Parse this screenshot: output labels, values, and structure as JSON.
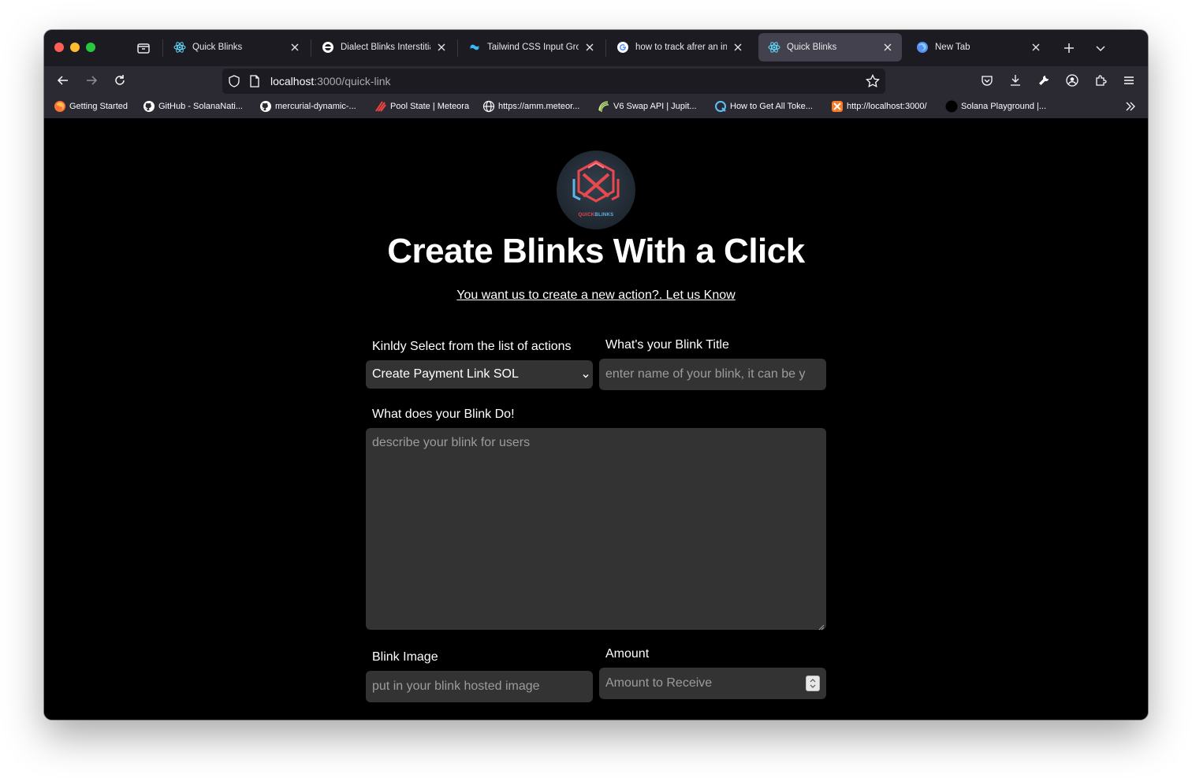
{
  "browser": {
    "tabs": [
      {
        "title": "Quick Blinks",
        "icon": "react-icon",
        "active": false
      },
      {
        "title": "Dialect Blinks Interstitial",
        "icon": "dialect-icon",
        "active": false
      },
      {
        "title": "Tailwind CSS Input Grou",
        "icon": "tailwind-icon",
        "active": false
      },
      {
        "title": "how to track afrer an inpu",
        "icon": "google-icon",
        "active": false
      },
      {
        "title": "Quick Blinks",
        "icon": "react-icon",
        "active": true
      },
      {
        "title": "New Tab",
        "icon": "firefox-icon",
        "active": false
      }
    ],
    "url": {
      "host": "localhost",
      "path": ":3000/quick-link"
    },
    "bookmarks": [
      {
        "label": "Getting Started",
        "icon": "firefox-icon"
      },
      {
        "label": "GitHub - SolanaNati...",
        "icon": "github-icon"
      },
      {
        "label": "mercurial-dynamic-...",
        "icon": "github-icon"
      },
      {
        "label": "Pool State | Meteora",
        "icon": "meteora-icon"
      },
      {
        "label": "https://amm.meteor...",
        "icon": "globe-icon"
      },
      {
        "label": "V6 Swap API | Jupit...",
        "icon": "jupiter-icon"
      },
      {
        "label": "How to Get All Toke...",
        "icon": "quicknode-icon"
      },
      {
        "label": "http://localhost:3000/",
        "icon": "xampp-icon"
      },
      {
        "label": "Solana Playground |...",
        "icon": "solana-playground-icon"
      }
    ]
  },
  "page": {
    "logo_text_red": "QUICK",
    "logo_text_blue": "BLINKS",
    "headline": "Create Blinks With a Click",
    "request_link": "You want us to create a new action?. Let us Know",
    "form": {
      "action_label": "Kinldy Select from the list of actions",
      "action_value": "Create Payment Link SOL",
      "title_label": "What's your Blink Title",
      "title_placeholder": "enter name of your blink, it can be y",
      "description_label": "What does your Blink Do!",
      "description_placeholder": "describe your blink for users",
      "image_label": "Blink Image",
      "image_placeholder": "put in your blink hosted image",
      "amount_label": "Amount",
      "amount_placeholder": "Amount to Receive"
    }
  }
}
